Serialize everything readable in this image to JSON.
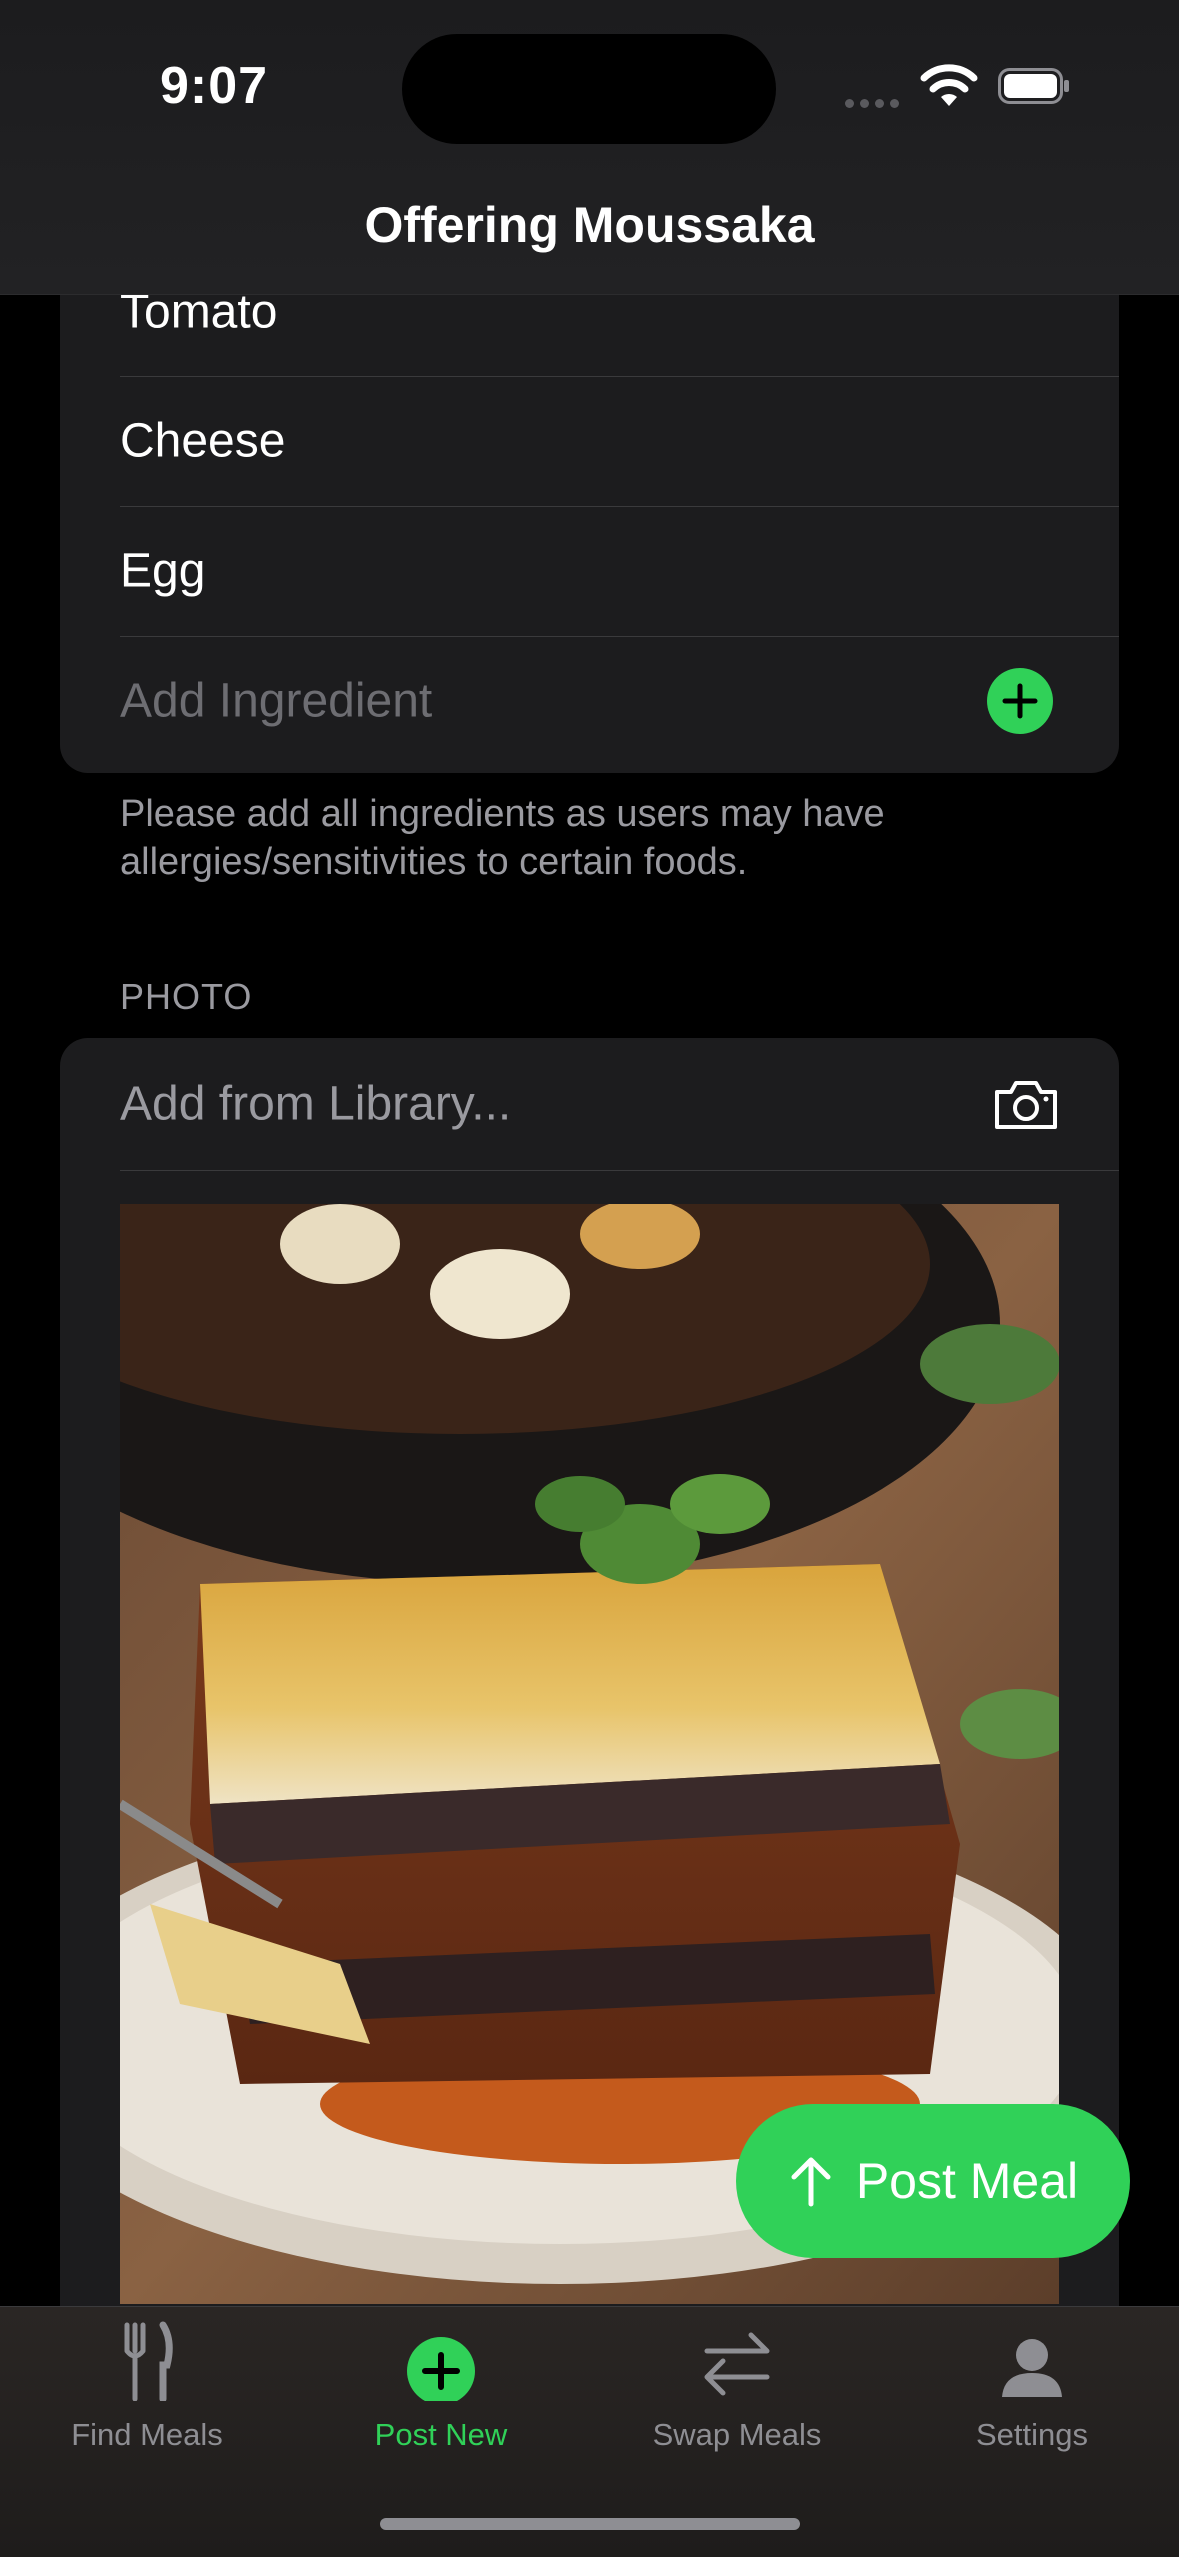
{
  "status_bar": {
    "time": "9:07",
    "icons": [
      "cellular-signal-icon",
      "wifi-icon",
      "battery-icon"
    ]
  },
  "nav": {
    "title": "Offering Moussaka"
  },
  "ingredients": {
    "items": [
      "Tomato",
      "Cheese",
      "Egg"
    ],
    "add_placeholder": "Add Ingredient",
    "footnote": "Please add all ingredients as users may have allergies/sensitivities to certain foods."
  },
  "photo": {
    "section_header": "PHOTO",
    "add_label": "Add from Library...",
    "image_alt": "moussaka-photo"
  },
  "post_button": {
    "label": "Post Meal"
  },
  "tabs": [
    {
      "label": "Find Meals",
      "icon": "fork-knife-icon",
      "active": false
    },
    {
      "label": "Post New",
      "icon": "plus-circle-icon",
      "active": true
    },
    {
      "label": "Swap Meals",
      "icon": "swap-arrows-icon",
      "active": false
    },
    {
      "label": "Settings",
      "icon": "person-icon",
      "active": false
    }
  ],
  "colors": {
    "accent": "#30d158",
    "background": "#000000",
    "card": "#1c1c1e",
    "secondary_text": "#9a9aa0"
  }
}
